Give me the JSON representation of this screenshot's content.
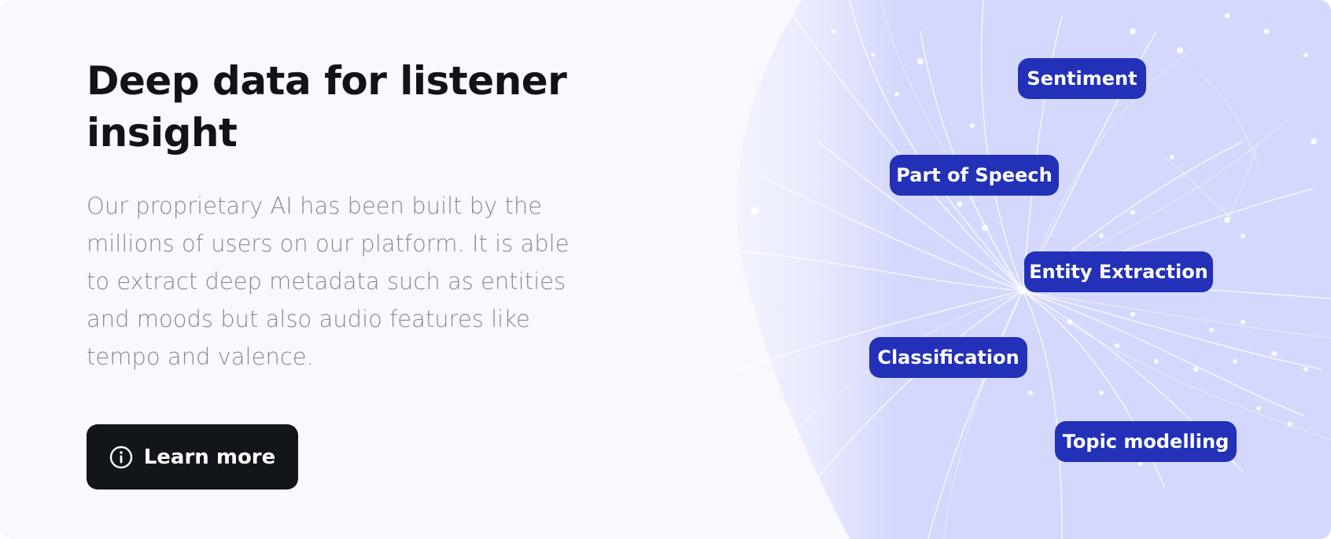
{
  "section": {
    "title": "Deep data for listener insight",
    "body": "Our proprietary AI has been built by the millions of users on our platform. It is able to extract deep metadata such as entities and moods but also audio features like tempo and valence.",
    "cta": {
      "label": "Learn more",
      "icon": "info-circle-icon"
    }
  },
  "tags": {
    "sentiment": "Sentiment",
    "part_of_speech": "Part of Speech",
    "entity_extraction": "Entity Extraction",
    "classification": "Classification",
    "topic_modelling": "Topic modelling"
  },
  "colors": {
    "card_background": "#f8f8fe",
    "visual_background": "#d4d8fc",
    "tag_background": "#2331b8",
    "button_background": "#12161a",
    "title_text": "#121317",
    "body_text": "#8a8a8f"
  }
}
